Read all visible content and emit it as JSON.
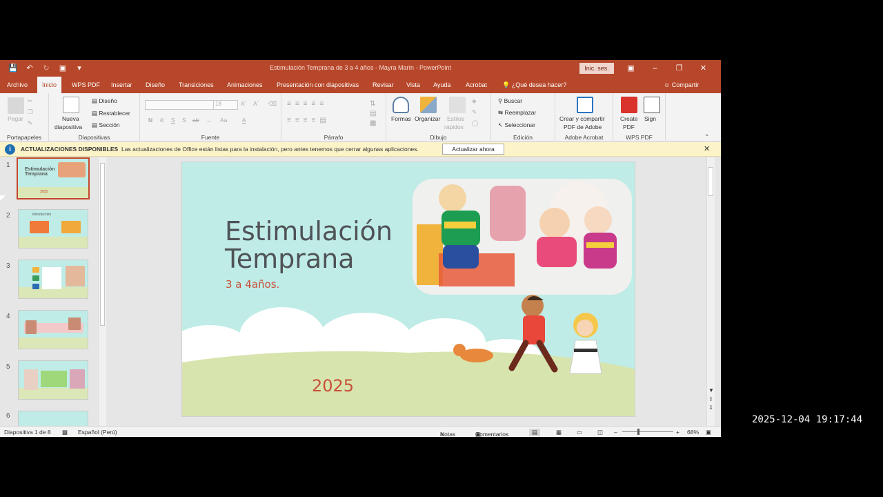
{
  "window": {
    "title": "Estimulación Temprana de 3 a 4 años - Mayra Marín  -  PowerPoint",
    "sign_in": "Inic. ses.",
    "accent": "#b7472a"
  },
  "tabs": [
    "Archivo",
    "Inicio",
    "WPS PDF",
    "Insertar",
    "Diseño",
    "Transiciones",
    "Animaciones",
    "Presentación con diapositivas",
    "Revisar",
    "Vista",
    "Ayuda",
    "Acrobat"
  ],
  "tell_me": "¿Qué desea hacer?",
  "share": "Compartir",
  "ribbon": {
    "clipboard": {
      "paste": "Pegar",
      "label": "Portapapeles"
    },
    "slides": {
      "new_slide_1": "Nueva",
      "new_slide_2": "diapositiva",
      "layout": "Diseño",
      "reset": "Restablecer",
      "section": "Sección",
      "label": "Diapositivas"
    },
    "font": {
      "size": "18",
      "label": "Fuente",
      "bold": "N",
      "italic": "K",
      "underline": "S",
      "shadow": "S",
      "spacing": "ab",
      "case": "Aa",
      "color": "A"
    },
    "paragraph": {
      "label": "Párrafo"
    },
    "drawing": {
      "shapes": "Formas",
      "arrange": "Organizar",
      "styles_1": "Estilos",
      "styles_2": "rápidos",
      "label": "Dibujo"
    },
    "editing": {
      "find": "Buscar",
      "replace": "Reemplazar",
      "select": "Seleccionar",
      "label": "Edición"
    },
    "adobe": {
      "create_1": "Crear y compartir",
      "create_2": "PDF de Adobe",
      "label": "Adobe Acrobat"
    },
    "wps": {
      "create_1": "Create",
      "create_2": "PDF",
      "sign": "Sign",
      "label": "WPS PDF"
    }
  },
  "infobar": {
    "title": "ACTUALIZACIONES DISPONIBLES",
    "message": "Las actualizaciones de Office están listas para la instalación, pero antes tenemos que cerrar algunas aplicaciones.",
    "button": "Actualizar ahora"
  },
  "thumbnails": [
    {
      "num": "1",
      "title": "Estimulación Temprana",
      "year": "2025"
    },
    {
      "num": "2",
      "title": "Introducción"
    },
    {
      "num": "3"
    },
    {
      "num": "4"
    },
    {
      "num": "5"
    },
    {
      "num": "6"
    }
  ],
  "slide": {
    "title_line1": "Estimulación",
    "title_line2": "Temprana",
    "subtitle": "3 a 4años.",
    "year": "2025"
  },
  "status": {
    "slide_count": "Diapositiva 1 de 8",
    "language": "Español (Perú)",
    "notes": "Notas",
    "comments": "Comentarios",
    "zoom": "68%"
  },
  "timestamp": "2025-12-04 19:17:44"
}
